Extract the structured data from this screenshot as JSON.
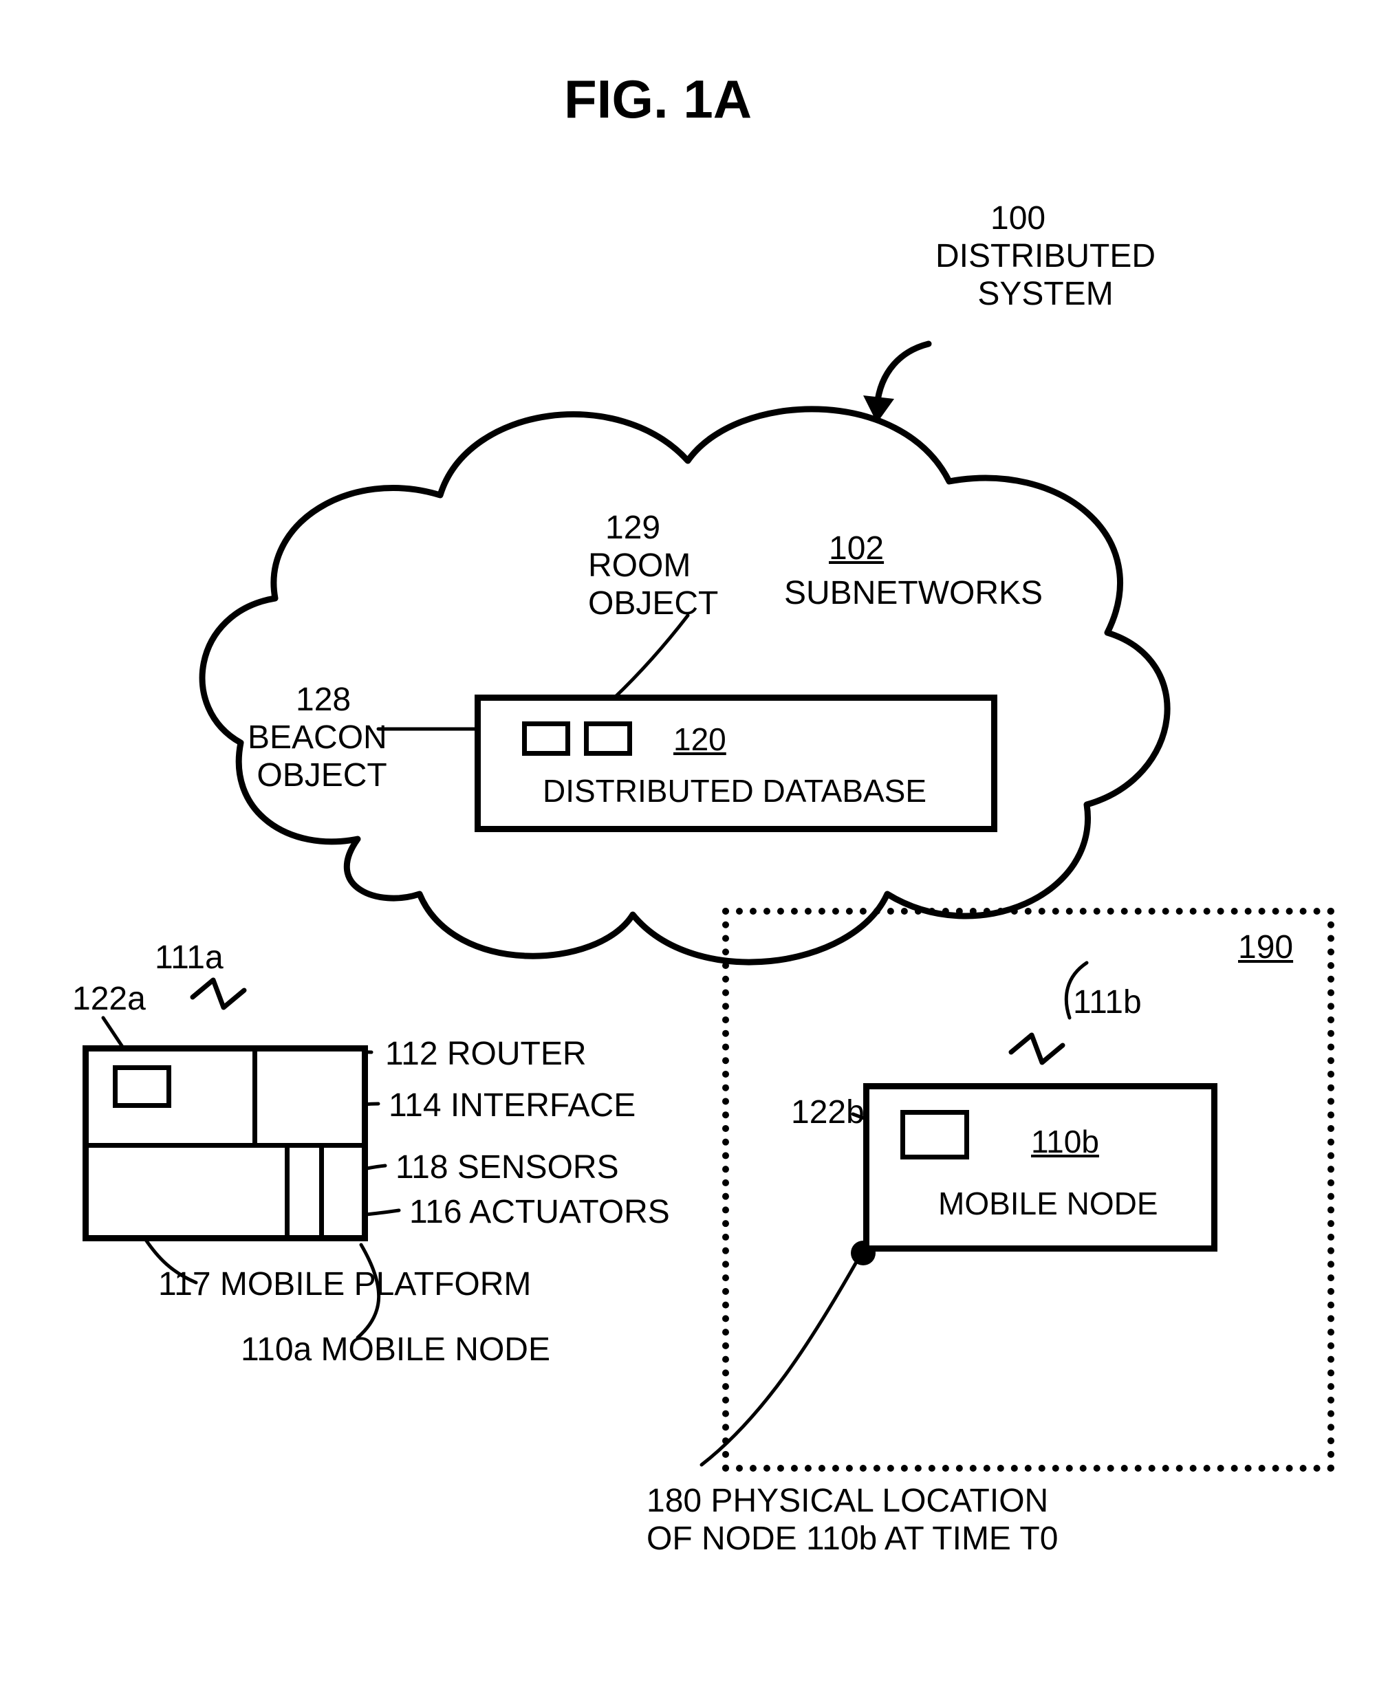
{
  "figure": {
    "title": "FIG. 1A",
    "labels": {
      "l100_num": "100",
      "l100_text": "DISTRIBUTED\nSYSTEM",
      "l129_num": "129",
      "l129_text": "ROOM\nOBJECT",
      "l102": "102",
      "l102_text": "SUBNETWORKS",
      "l128_num": "128",
      "l128_text": "BEACON\nOBJECT",
      "l120": "120",
      "l120_text": "DISTRIBUTED DATABASE",
      "l190": "190",
      "l111a": "111a",
      "l122a": "122a",
      "l111b": "111b",
      "l122b": "122b",
      "l110b": "110b",
      "l110b_text": "MOBILE NODE",
      "l112": "112 ROUTER",
      "l114": "114 INTERFACE",
      "l118": "118 SENSORS",
      "l116": "116 ACTUATORS",
      "l117": "117 MOBILE PLATFORM",
      "l110a": "110a MOBILE NODE",
      "l180": "180 PHYSICAL LOCATION\nOF NODE 110b AT TIME T0"
    }
  }
}
